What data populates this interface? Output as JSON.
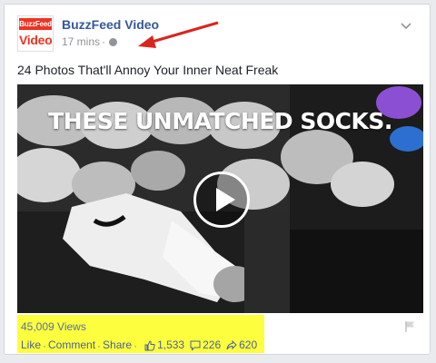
{
  "post": {
    "page_name": "BuzzFeed Video",
    "avatar_top": "BuzzFeed",
    "avatar_bottom": "Video",
    "time": "17 mins",
    "separator": "·",
    "caption": "24 Photos That'll Annoy Your Inner Neat Freak"
  },
  "video": {
    "title_text": "THESE UNMATCHED SOCKS."
  },
  "stats": {
    "views": "45,009 Views",
    "like_label": "Like",
    "comment_label": "Comment",
    "share_label": "Share",
    "dot": "·",
    "likes_count": "1,533",
    "comments_count": "226",
    "shares_count": "620"
  },
  "colors": {
    "link_blue": "#365899",
    "highlight_yellow": "#fdff3e",
    "annotation_arrow": "#d8261f",
    "buzzfeed_red": "#ee3322"
  },
  "icons": [
    "globe-icon",
    "chevron-down-icon",
    "play-icon",
    "thumbs-up-icon",
    "comment-icon",
    "share-icon",
    "flag-icon"
  ]
}
